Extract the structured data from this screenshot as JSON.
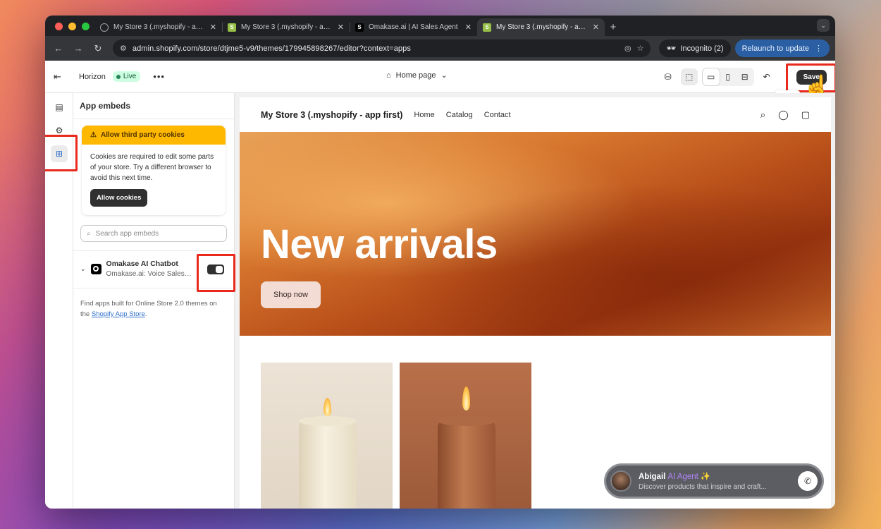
{
  "browser": {
    "tabs": [
      {
        "title": "My Store 3 (.myshopify - app first)",
        "favicon": "globe-icon"
      },
      {
        "title": "My Store 3 (.myshopify - app first)",
        "favicon": "shopify-icon"
      },
      {
        "title": "Omakase.ai | AI Sales Agent",
        "favicon": "omakase-icon"
      },
      {
        "title": "My Store 3 (.myshopify - app first)",
        "favicon": "shopify-icon"
      }
    ],
    "url": "admin.shopify.com/store/dtjme5-v9/themes/179945898267/editor?context=apps",
    "incognito_label": "Incognito (2)",
    "relaunch_label": "Relaunch to update"
  },
  "editor": {
    "theme_name": "Horizon",
    "live_label": "Live",
    "page_select": "Home page",
    "save_label": "Save",
    "save_tooltip": "Save"
  },
  "panel": {
    "title": "App embeds",
    "cookie_title": "Allow third party cookies",
    "cookie_body": "Cookies are required to edit some parts of your store. Try a different browser to avoid this next time.",
    "cookie_button": "Allow cookies",
    "search_placeholder": "Search app embeds",
    "embed": {
      "name": "Omakase AI Chatbot",
      "subtitle": "Omakase.ai: Voice Sales A...",
      "enabled": true
    },
    "find_apps_text": "Find apps built for Online Store 2.0 themes on the ",
    "find_apps_link": "Shopify App Store",
    "find_apps_end": "."
  },
  "preview": {
    "store_name": "My Store 3 (.myshopify - app first)",
    "nav_links": [
      "Home",
      "Catalog",
      "Contact"
    ],
    "hero_title": "New arrivals",
    "hero_button": "Shop now"
  },
  "chat": {
    "name": "Abigail",
    "role": "AI Agent",
    "subtitle": "Discover products that inspire and craft..."
  },
  "colors": {
    "save_highlight": "#e8291c",
    "cookie_banner": "#ffb800",
    "live_badge": "#cdfee1"
  }
}
